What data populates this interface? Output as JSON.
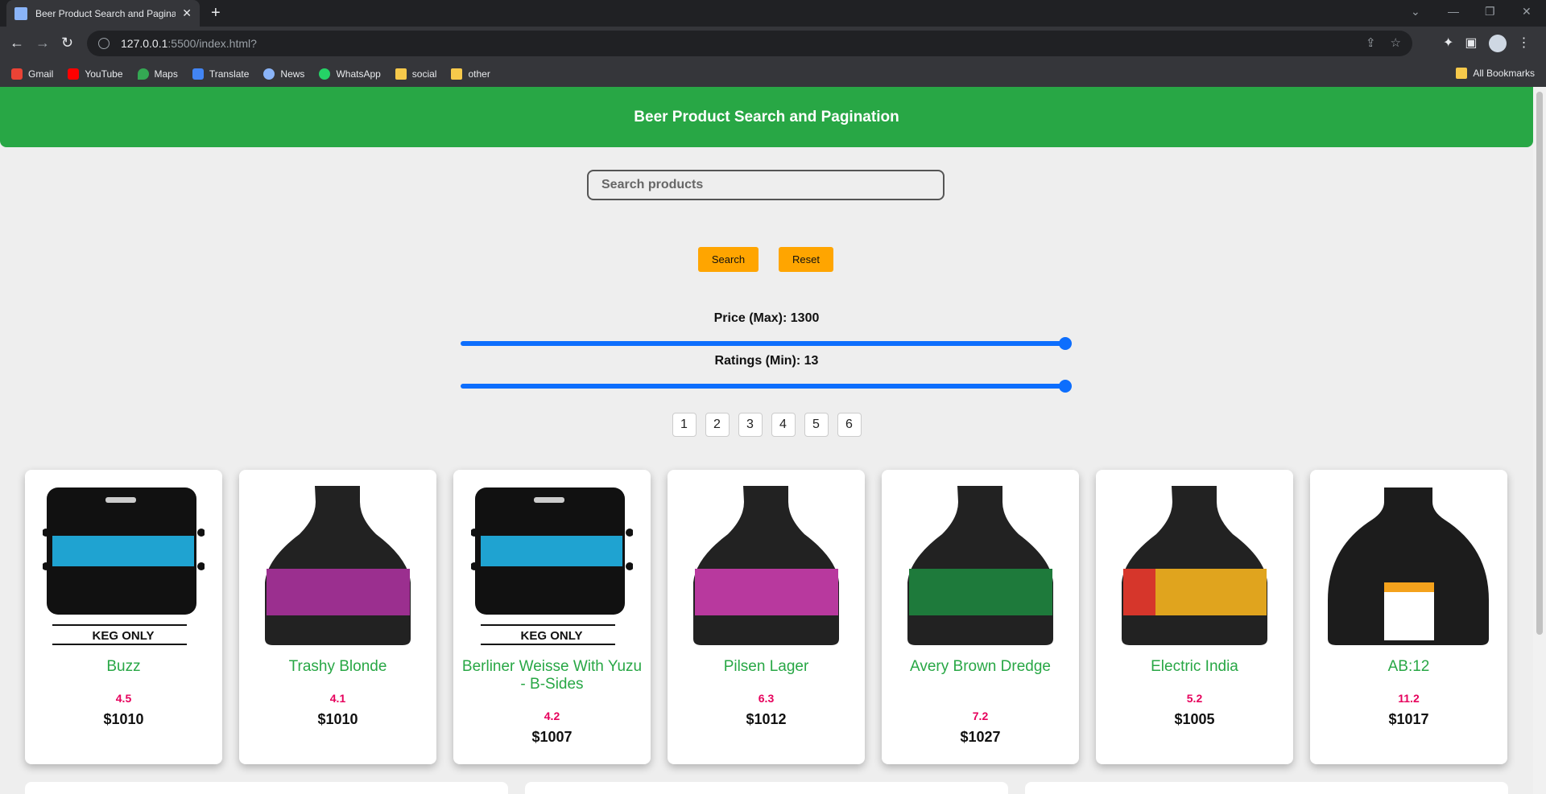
{
  "browser": {
    "tab_title": "Beer Product Search and Paginat",
    "url_host": "127.0.0.1",
    "url_path": ":5500/index.html?",
    "bookmarks": [
      "Gmail",
      "YouTube",
      "Maps",
      "Translate",
      "News",
      "WhatsApp",
      "social",
      "other"
    ],
    "all_bookmarks": "All Bookmarks"
  },
  "page": {
    "title": "Beer Product Search and Pagination",
    "search_placeholder": "Search products",
    "search_button": "Search",
    "reset_button": "Reset",
    "price_label": "Price (Max): 1300",
    "ratings_label": "Ratings (Min): 13",
    "price_max_value": 1300,
    "ratings_min_value": 13,
    "pages": [
      "1",
      "2",
      "3",
      "4",
      "5",
      "6"
    ]
  },
  "products": [
    {
      "name": "Buzz",
      "rating": "4.5",
      "price": "$1010",
      "image": "keg",
      "label_color": "#1fa3d1"
    },
    {
      "name": "Trashy Blonde",
      "rating": "4.1",
      "price": "$1010",
      "image": "bottle",
      "label_color": "#9b2f8f"
    },
    {
      "name": "Berliner Weisse With Yuzu - B-Sides",
      "rating": "4.2",
      "price": "$1007",
      "image": "keg",
      "label_color": "#1fa3d1"
    },
    {
      "name": "Pilsen Lager",
      "rating": "6.3",
      "price": "$1012",
      "image": "bottle",
      "label_color": "#b8399e"
    },
    {
      "name": "Avery Brown Dredge",
      "rating": "7.2",
      "price": "$1027",
      "image": "bottle",
      "label_color": "#1e7a3b"
    },
    {
      "name": "Electric India",
      "rating": "5.2",
      "price": "$1005",
      "image": "bottle",
      "label_color": "#e0a41e"
    },
    {
      "name": "AB:12",
      "rating": "11.2",
      "price": "$1017",
      "image": "stubby",
      "label_color": "#f4a21c"
    }
  ],
  "keg_text": "KEG ONLY",
  "colors": {
    "accent": "#28a745",
    "button": "#ffa500",
    "slider": "#0d6efd",
    "rating": "#e6005c"
  }
}
